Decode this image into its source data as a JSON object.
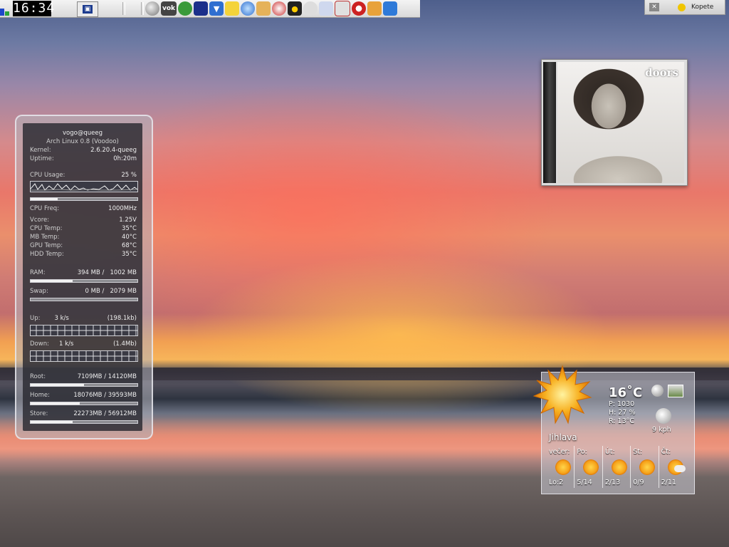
{
  "taskbar": {
    "clock": "16:34",
    "tray_items": [
      {
        "icon": "moon-icon"
      },
      {
        "icon": "vok-icon",
        "label": "vok"
      },
      {
        "icon": "chat-bubbles-icon"
      },
      {
        "icon": "coffee-mug-icon"
      },
      {
        "icon": "download-arrow-icon"
      },
      {
        "icon": "sticky-note-icon"
      },
      {
        "icon": "blue-orb-icon"
      },
      {
        "icon": "keys-icon"
      },
      {
        "icon": "compass-icon"
      },
      {
        "icon": "linux-tux-icon"
      },
      {
        "icon": "speech-bubble-icon"
      },
      {
        "icon": "mail-icon"
      },
      {
        "icon": "card-icon"
      },
      {
        "icon": "lifebuoy-icon"
      },
      {
        "icon": "folder-icon"
      },
      {
        "icon": "database-icon"
      }
    ]
  },
  "kopete": {
    "label": "Kopete"
  },
  "album": {
    "logo_text": "doors"
  },
  "sysmon": {
    "user_host": "vogo@queeg",
    "distro": "Arch Linux 0.8 (Voodoo)",
    "kernel_label": "Kernel:",
    "kernel_value": "2.6.20.4-queeg",
    "uptime_label": "Uptime:",
    "uptime_value": "0h:20m",
    "cpu_usage_label": "CPU Usage:",
    "cpu_usage_value": "25 %",
    "cpu_usage_fraction": 0.25,
    "cpu_freq_label": "CPU Freq:",
    "cpu_freq_value": "1000MHz",
    "sensors": [
      {
        "label": "Vcore:",
        "value": "1.25V"
      },
      {
        "label": "CPU Temp:",
        "value": "35°C"
      },
      {
        "label": "MB Temp:",
        "value": "40°C"
      },
      {
        "label": "GPU Temp:",
        "value": "68°C"
      },
      {
        "label": "HDD Temp:",
        "value": "35°C"
      }
    ],
    "ram_label": "RAM:",
    "ram_value": "394 MB /   1002 MB",
    "ram_fraction": 0.39,
    "swap_label": "Swap:",
    "swap_value": "0 MB /   2079 MB",
    "swap_fraction": 0.0,
    "up_label": "Up:",
    "up_rate": "3 k/s",
    "up_total": "(198.1kb)",
    "down_label": "Down:",
    "down_rate": "1 k/s",
    "down_total": "(1.4Mb)",
    "disks": [
      {
        "label": "Root:",
        "value": "7109MB / 14120MB",
        "fraction": 0.5
      },
      {
        "label": "Home:",
        "value": "18076MB / 39593MB",
        "fraction": 0.46
      },
      {
        "label": "Store:",
        "value": "22273MB / 56912MB",
        "fraction": 0.39
      }
    ]
  },
  "weather": {
    "temperature": "16˚C",
    "pressure": "P: 1030",
    "humidity": "H: 27 %",
    "realfeel": "R: 13°C",
    "wind": "9 kph",
    "city": "Jihlava",
    "forecast": [
      {
        "day": "večer:",
        "temp": "Lo:2",
        "icon": "sun-icon"
      },
      {
        "day": "Po:",
        "temp": "5/14",
        "icon": "sun-icon"
      },
      {
        "day": "Út:",
        "temp": "2/13",
        "icon": "sun-icon"
      },
      {
        "day": "St:",
        "temp": "0/9",
        "icon": "sun-icon"
      },
      {
        "day": "Čt:",
        "temp": "2/11",
        "icon": "sun-cloud-icon"
      }
    ]
  }
}
